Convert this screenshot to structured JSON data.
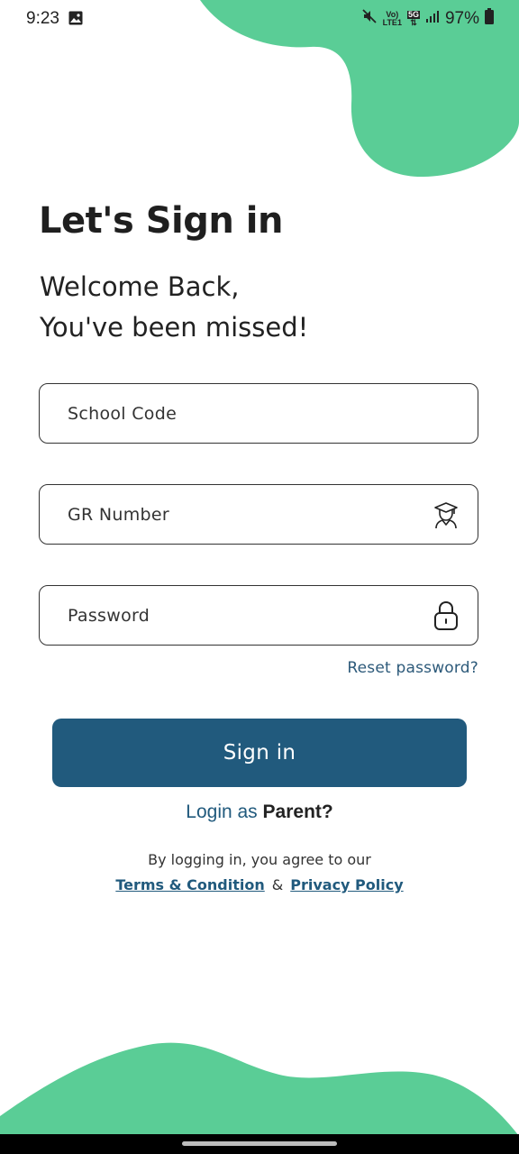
{
  "status_bar": {
    "time": "9:23",
    "network_top": "Vo)",
    "network_bottom": "LTE1",
    "network_type": "5G",
    "battery": "97%"
  },
  "colors": {
    "accent_green": "#5acd96",
    "primary_blue": "#215a7d"
  },
  "header": {
    "title": "Let's Sign in",
    "subtitle_line1": "Welcome Back,",
    "subtitle_line2": "You've been missed!"
  },
  "form": {
    "school_code_placeholder": "School Code",
    "gr_number_placeholder": "GR Number",
    "password_placeholder": "Password",
    "gr_icon": "student-icon",
    "password_icon": "lock-icon",
    "reset_link": "Reset password?"
  },
  "actions": {
    "signin_label": "Sign in",
    "login_as_prefix": "Login as",
    "login_as_parent": "Parent?"
  },
  "footer": {
    "agree_text": "By logging in, you agree to our",
    "terms_link": "Terms & Condition",
    "ampersand": "&",
    "privacy_link": "Privacy Policy"
  }
}
